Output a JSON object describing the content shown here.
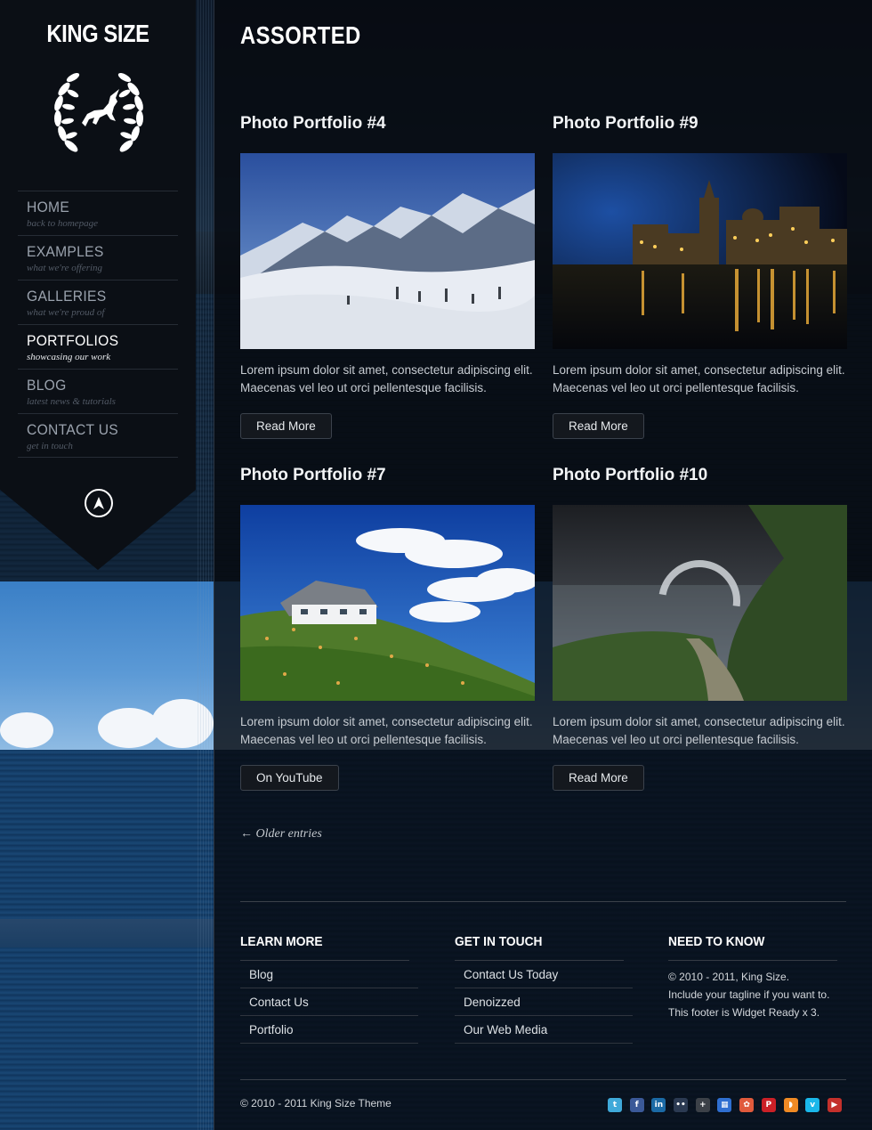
{
  "site": {
    "name": "KING SIZE"
  },
  "nav": {
    "items": [
      {
        "title": "HOME",
        "subtitle": "back to homepage",
        "active": false
      },
      {
        "title": "EXAMPLES",
        "subtitle": "what we're offering",
        "active": false
      },
      {
        "title": "GALLERIES",
        "subtitle": "what we're proud of",
        "active": false
      },
      {
        "title": "PORTFOLIOS",
        "subtitle": "showcasing our work",
        "active": true
      },
      {
        "title": "BLOG",
        "subtitle": "latest news & tutorials",
        "active": false
      },
      {
        "title": "CONTACT US",
        "subtitle": "get in touch",
        "active": false
      }
    ]
  },
  "page": {
    "title": "ASSORTED"
  },
  "posts": [
    {
      "title": "Photo Portfolio #4",
      "image": "snowy-mountains",
      "excerpt": "Lorem ipsum dolor sit amet, consectetur adipiscing elit. Maecenas vel leo ut orci pellentesque facilisis.",
      "button": "Read More"
    },
    {
      "title": "Photo Portfolio #9",
      "image": "city-night-river",
      "excerpt": "Lorem ipsum dolor sit amet, consectetur adipiscing elit. Maecenas vel leo ut orci pellentesque facilisis.",
      "button": "Read More"
    },
    {
      "title": "Photo Portfolio #7",
      "image": "house-on-flower-hill",
      "excerpt": "Lorem ipsum dolor sit amet, consectetur adipiscing elit. Maecenas vel leo ut orci pellentesque facilisis.",
      "button": "On YouTube"
    },
    {
      "title": "Photo Portfolio #10",
      "image": "stormy-road",
      "excerpt": "Lorem ipsum dolor sit amet, consectetur adipiscing elit. Maecenas vel leo ut orci pellentesque facilisis.",
      "button": "Read More"
    }
  ],
  "pagination": {
    "older": "← Older entries"
  },
  "footer": {
    "learn_more": {
      "title": "LEARN MORE",
      "links": [
        "Blog",
        "Contact Us",
        "Portfolio"
      ]
    },
    "get_in_touch": {
      "title": "GET IN TOUCH",
      "links": [
        "Contact Us Today",
        "Denoizzed",
        "Our Web Media"
      ]
    },
    "need_to_know": {
      "title": "NEED TO KNOW",
      "lines": [
        "© 2010 - 2011, King Size.",
        "Include your tagline if you want to.",
        "This footer is Widget Ready x 3."
      ]
    },
    "copyright": "© 2010 - 2011 King Size Theme",
    "social": [
      {
        "name": "twitter-icon",
        "glyph": "t",
        "color": "#3fa9d9"
      },
      {
        "name": "facebook-icon",
        "glyph": "f",
        "color": "#3b5998"
      },
      {
        "name": "linkedin-icon",
        "glyph": "in",
        "color": "#1b6aa5"
      },
      {
        "name": "flickr-icon",
        "glyph": "••",
        "color": "#2b3a52"
      },
      {
        "name": "google-plus-icon",
        "glyph": "+",
        "color": "#3c4148"
      },
      {
        "name": "delicious-icon",
        "glyph": "▦",
        "color": "#2f6fd1"
      },
      {
        "name": "picasa-icon",
        "glyph": "✿",
        "color": "#e05a3c"
      },
      {
        "name": "pinterest-icon",
        "glyph": "P",
        "color": "#cb2027"
      },
      {
        "name": "rss-icon",
        "glyph": "◗",
        "color": "#f08a24"
      },
      {
        "name": "vimeo-icon",
        "glyph": "v",
        "color": "#1ab7ea"
      },
      {
        "name": "youtube-icon",
        "glyph": "▶",
        "color": "#c4302b"
      }
    ]
  }
}
